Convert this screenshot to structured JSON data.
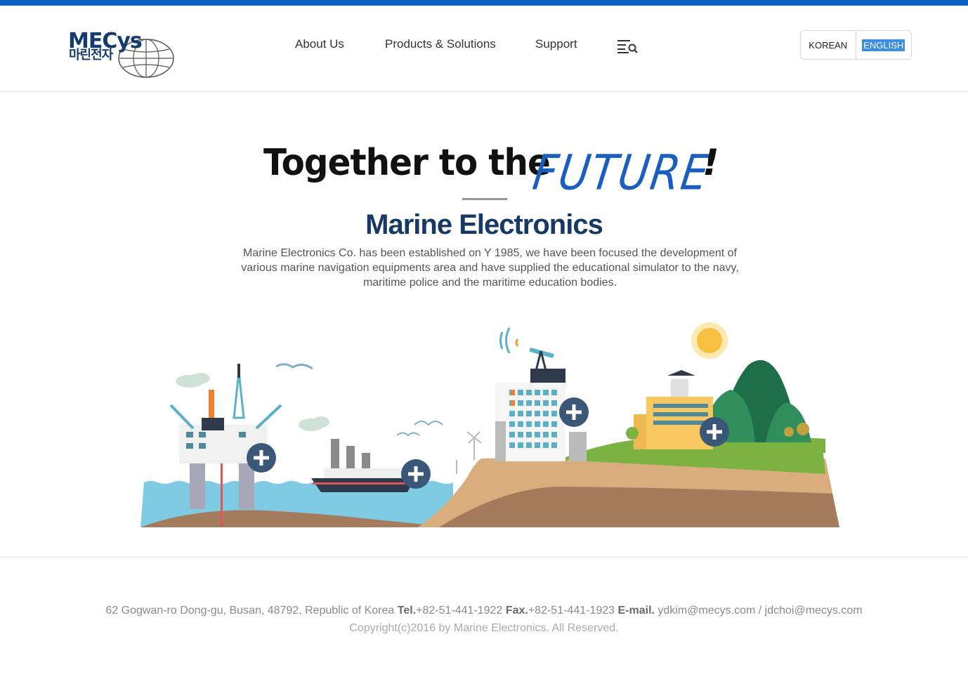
{
  "brand": {
    "logo_text": "MECys",
    "logo_sub": "마린전자"
  },
  "nav": {
    "items": [
      {
        "label": "About Us"
      },
      {
        "label": "Products & Solutions"
      },
      {
        "label": "Support"
      }
    ],
    "search_icon": "menu-search-icon"
  },
  "lang": {
    "korean": "KOREAN",
    "english": "ENGLISH",
    "selected": "ENGLISH"
  },
  "hero": {
    "headline_part1": "Together to the",
    "headline_part2": "FUTURE",
    "headline_part3": "!",
    "title": "Marine Electronics",
    "description": "Marine Electronics Co. has been established on Y 1985, we have been focused the development of various marine navigation equipments area and have supplied the educational simulator to the navy, maritime police and the maritime education bodies."
  },
  "footer": {
    "address": "62 Gogwan-ro Dong-gu, Busan, 48792, Republic of Korea",
    "tel_label": "Tel.",
    "tel": "+82-51-441-1922",
    "fax_label": "Fax.",
    "fax": "+82-51-441-1923",
    "email_label": "E-mail.",
    "email": "ydkim@mecys.com / jdchoi@mecys.com",
    "copyright": "Copyright(c)2016 by Marine Electronics. All Reserved."
  },
  "colors": {
    "brand_blue": "#0a5fc4",
    "navy": "#173966",
    "sea": "#7fcbe3",
    "grass": "#7bb241",
    "sand": "#d9ae7c"
  }
}
